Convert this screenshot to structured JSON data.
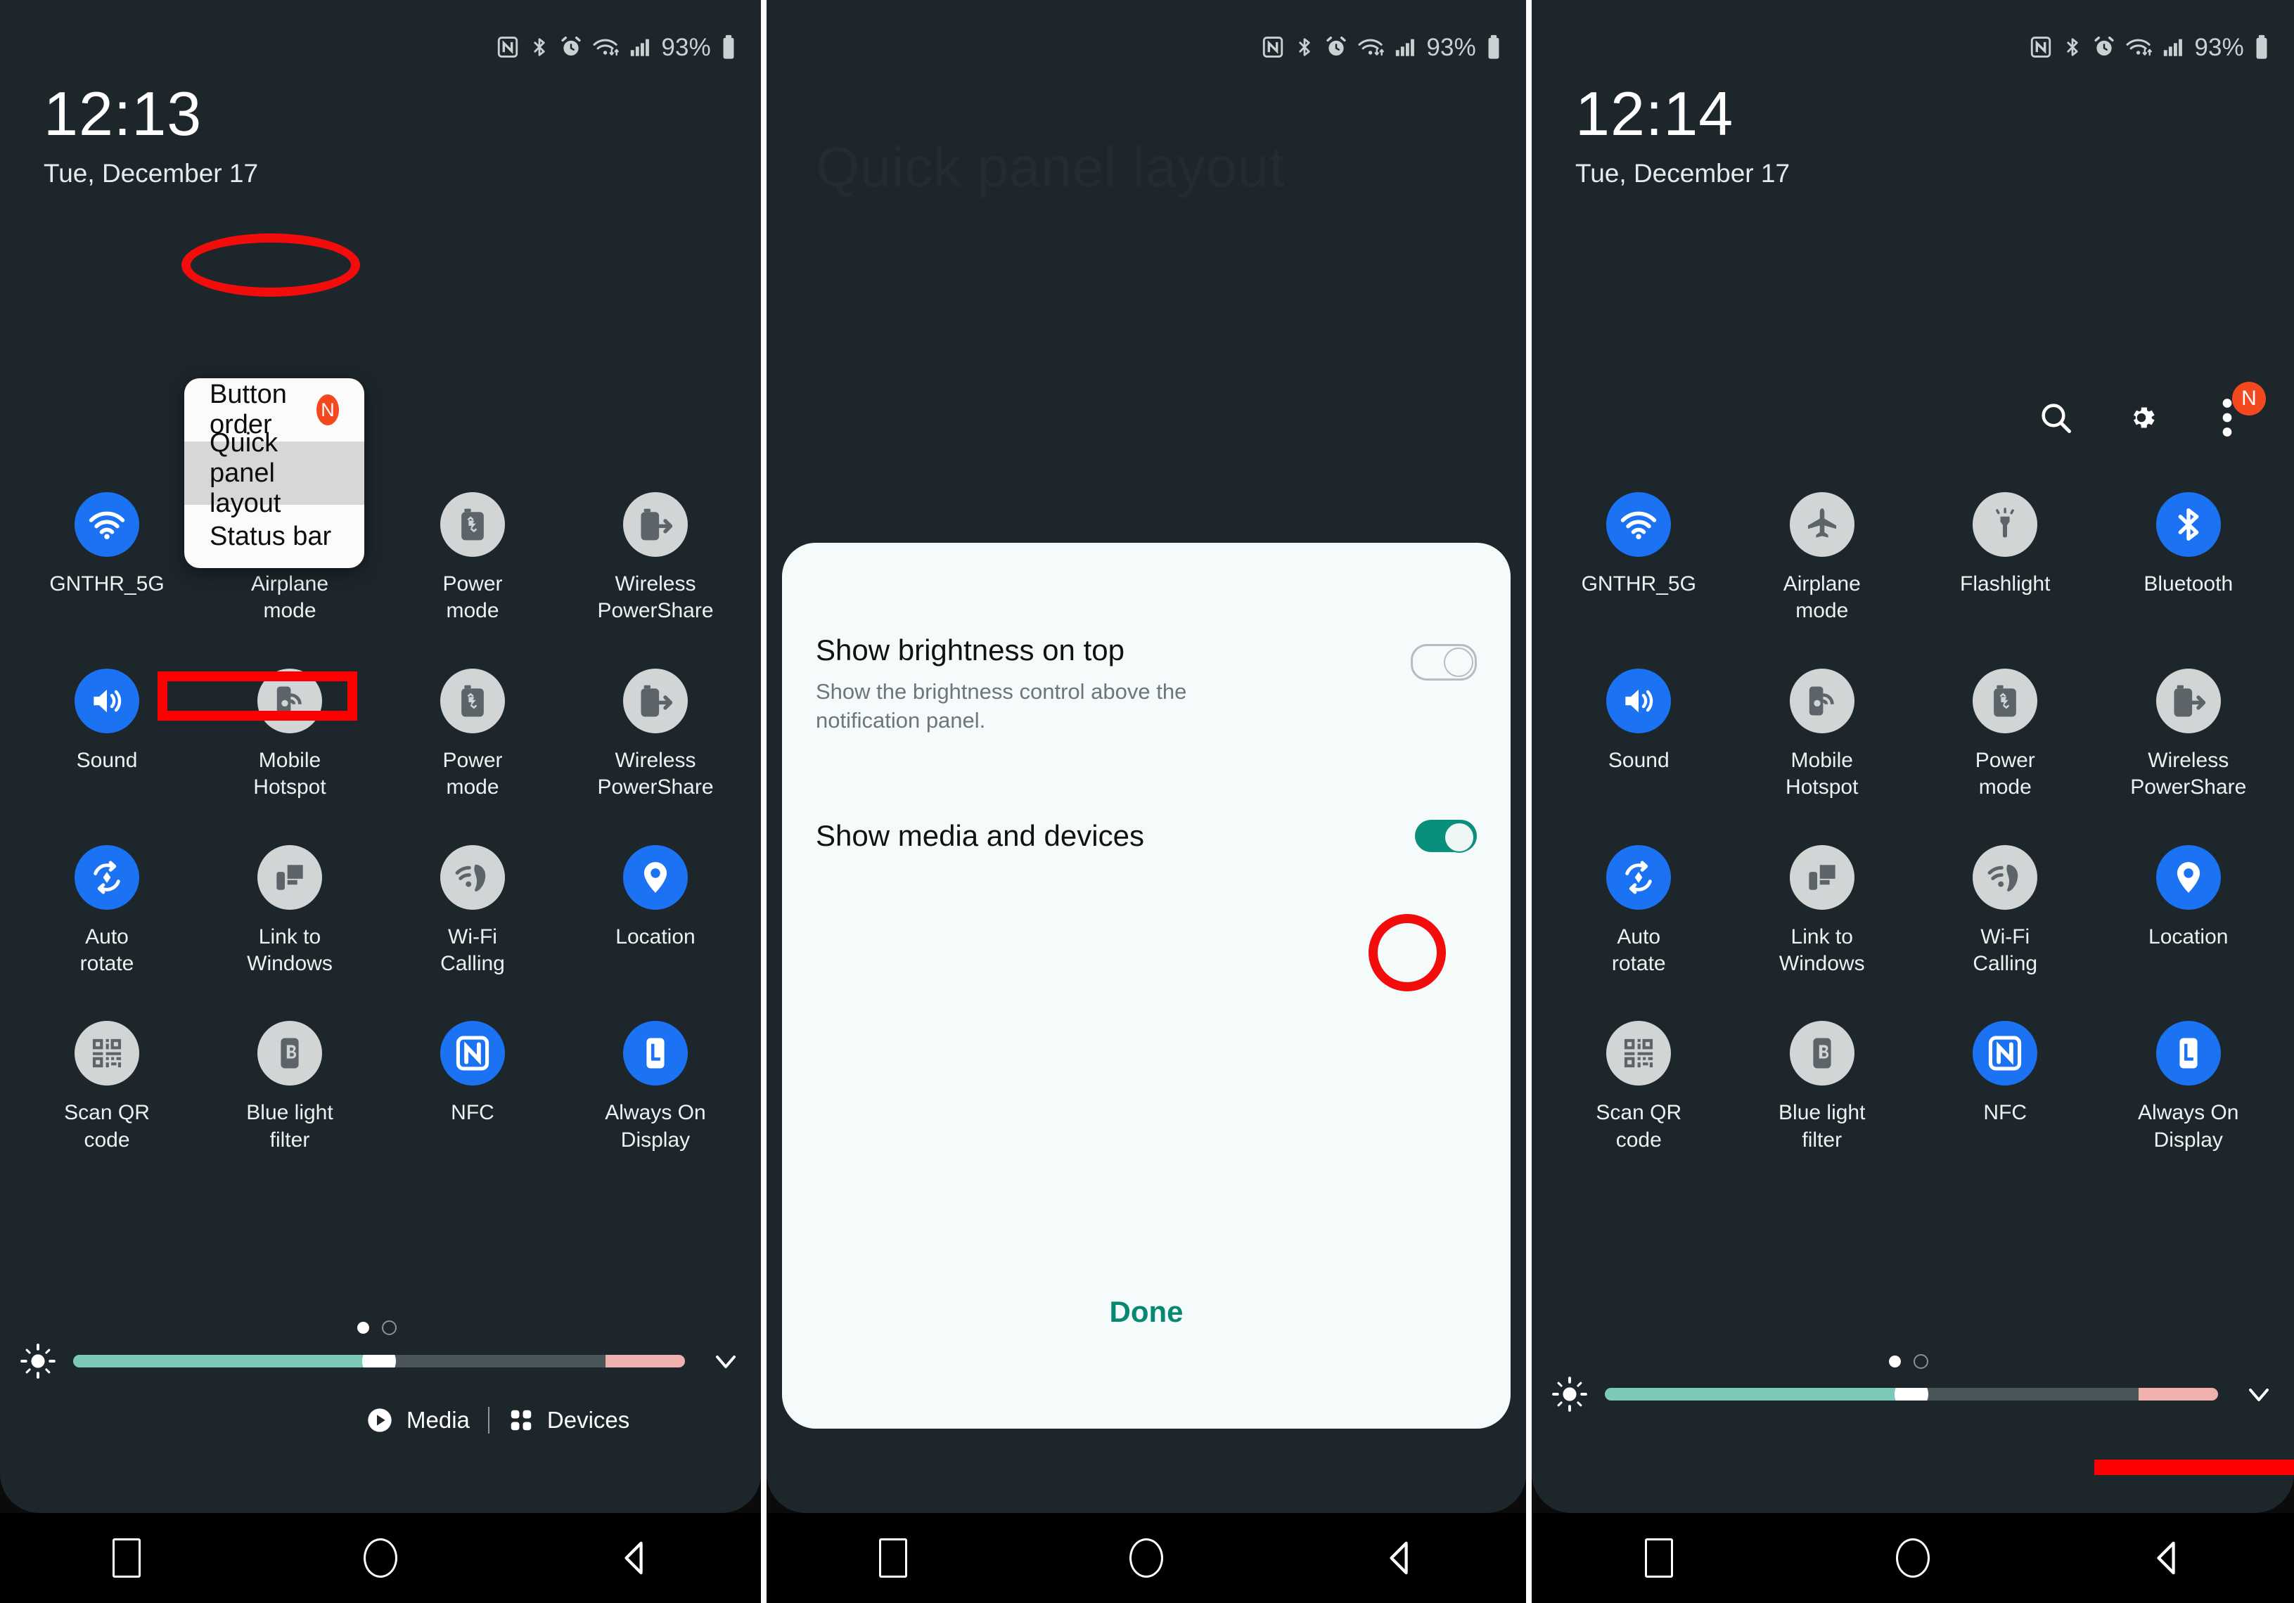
{
  "status_bar": {
    "icons": [
      "nfc-icon",
      "bluetooth-icon",
      "alarm-icon",
      "wifi-icon",
      "signal-icon"
    ],
    "battery_percent": "93%"
  },
  "panel1": {
    "clock": {
      "time": "12:13",
      "date": "Tue, December 17"
    },
    "popup_menu": {
      "items": [
        {
          "label": "Button order",
          "badge": "N",
          "selected": false
        },
        {
          "label": "Quick panel layout",
          "badge": "",
          "selected": true
        },
        {
          "label": "Status bar",
          "badge": "",
          "selected": false
        }
      ]
    },
    "tiles": [
      {
        "label": "GNTHR_5G",
        "icon": "wifi-icon",
        "state": "on"
      },
      {
        "label": "Airplane\nmode",
        "icon": "airplane-icon",
        "state": "off"
      },
      {
        "label": "Power\nmode",
        "icon": "power-mode-icon",
        "state": "off"
      },
      {
        "label": "Wireless\nPowerShare",
        "icon": "wireless-powershare-icon",
        "state": "off"
      },
      {
        "label": "Sound",
        "icon": "sound-icon",
        "state": "on"
      },
      {
        "label": "Mobile\nHotspot",
        "icon": "mobile-hotspot-icon",
        "state": "off"
      },
      {
        "label": "Power\nmode",
        "icon": "power-mode-icon",
        "state": "off"
      },
      {
        "label": "Wireless\nPowerShare",
        "icon": "wireless-powershare-icon",
        "state": "off"
      },
      {
        "label": "Auto\nrotate",
        "icon": "auto-rotate-icon",
        "state": "on"
      },
      {
        "label": "Link to\nWindows",
        "icon": "link-to-windows-icon",
        "state": "off"
      },
      {
        "label": "Wi-Fi\nCalling",
        "icon": "wifi-calling-icon",
        "state": "off"
      },
      {
        "label": "Location",
        "icon": "location-icon",
        "state": "on"
      },
      {
        "label": "Scan QR\ncode",
        "icon": "qr-code-icon",
        "state": "off"
      },
      {
        "label": "Blue light\nfilter",
        "icon": "blue-light-filter-icon",
        "state": "off"
      },
      {
        "label": "NFC",
        "icon": "nfc-icon",
        "state": "on"
      },
      {
        "label": "Always On\nDisplay",
        "icon": "always-on-display-icon",
        "state": "on"
      }
    ],
    "media_bar": {
      "media_label": "Media",
      "devices_label": "Devices"
    },
    "brightness_percent": 50
  },
  "panel2": {
    "background_title": "Quick panel layout",
    "dialog": {
      "rows": [
        {
          "title": "Show brightness on top",
          "description": "Show the brightness control above the notification panel.",
          "toggle": "off"
        },
        {
          "title": "Show media and devices",
          "description": "",
          "toggle": "on"
        }
      ],
      "done_label": "Done"
    }
  },
  "panel3": {
    "clock": {
      "time": "12:14",
      "date": "Tue, December 17"
    },
    "header_actions": [
      {
        "name": "search-icon",
        "badge": ""
      },
      {
        "name": "gear-icon",
        "badge": ""
      },
      {
        "name": "more-options-icon",
        "badge": "N"
      }
    ],
    "tiles": [
      {
        "label": "GNTHR_5G",
        "icon": "wifi-icon",
        "state": "on"
      },
      {
        "label": "Airplane\nmode",
        "icon": "airplane-icon",
        "state": "off"
      },
      {
        "label": "Flashlight",
        "icon": "flashlight-icon",
        "state": "off"
      },
      {
        "label": "Bluetooth",
        "icon": "bluetooth-icon",
        "state": "on"
      },
      {
        "label": "Sound",
        "icon": "sound-icon",
        "state": "on"
      },
      {
        "label": "Mobile\nHotspot",
        "icon": "mobile-hotspot-icon",
        "state": "off"
      },
      {
        "label": "Power\nmode",
        "icon": "power-mode-icon",
        "state": "off"
      },
      {
        "label": "Wireless\nPowerShare",
        "icon": "wireless-powershare-icon",
        "state": "off"
      },
      {
        "label": "Auto\nrotate",
        "icon": "auto-rotate-icon",
        "state": "on"
      },
      {
        "label": "Link to\nWindows",
        "icon": "link-to-windows-icon",
        "state": "off"
      },
      {
        "label": "Wi-Fi\nCalling",
        "icon": "wifi-calling-icon",
        "state": "off"
      },
      {
        "label": "Location",
        "icon": "location-icon",
        "state": "on"
      },
      {
        "label": "Scan QR\ncode",
        "icon": "qr-code-icon",
        "state": "off"
      },
      {
        "label": "Blue light\nfilter",
        "icon": "blue-light-filter-icon",
        "state": "off"
      },
      {
        "label": "NFC",
        "icon": "nfc-icon",
        "state": "on"
      },
      {
        "label": "Always On\nDisplay",
        "icon": "always-on-display-icon",
        "state": "on"
      }
    ],
    "brightness_percent": 50
  },
  "nav_bar": {
    "recents": "recents-icon",
    "home": "home-icon",
    "back": "back-icon"
  },
  "colors": {
    "accent_on": "#1b72f2",
    "tile_off": "#d2d5d6",
    "shade_bg": "#1d262b",
    "annotation_red": "#fe0000",
    "toggle_on_green": "#0a8f7c",
    "done_green": "#068872",
    "badge_orange": "#f4481f"
  }
}
